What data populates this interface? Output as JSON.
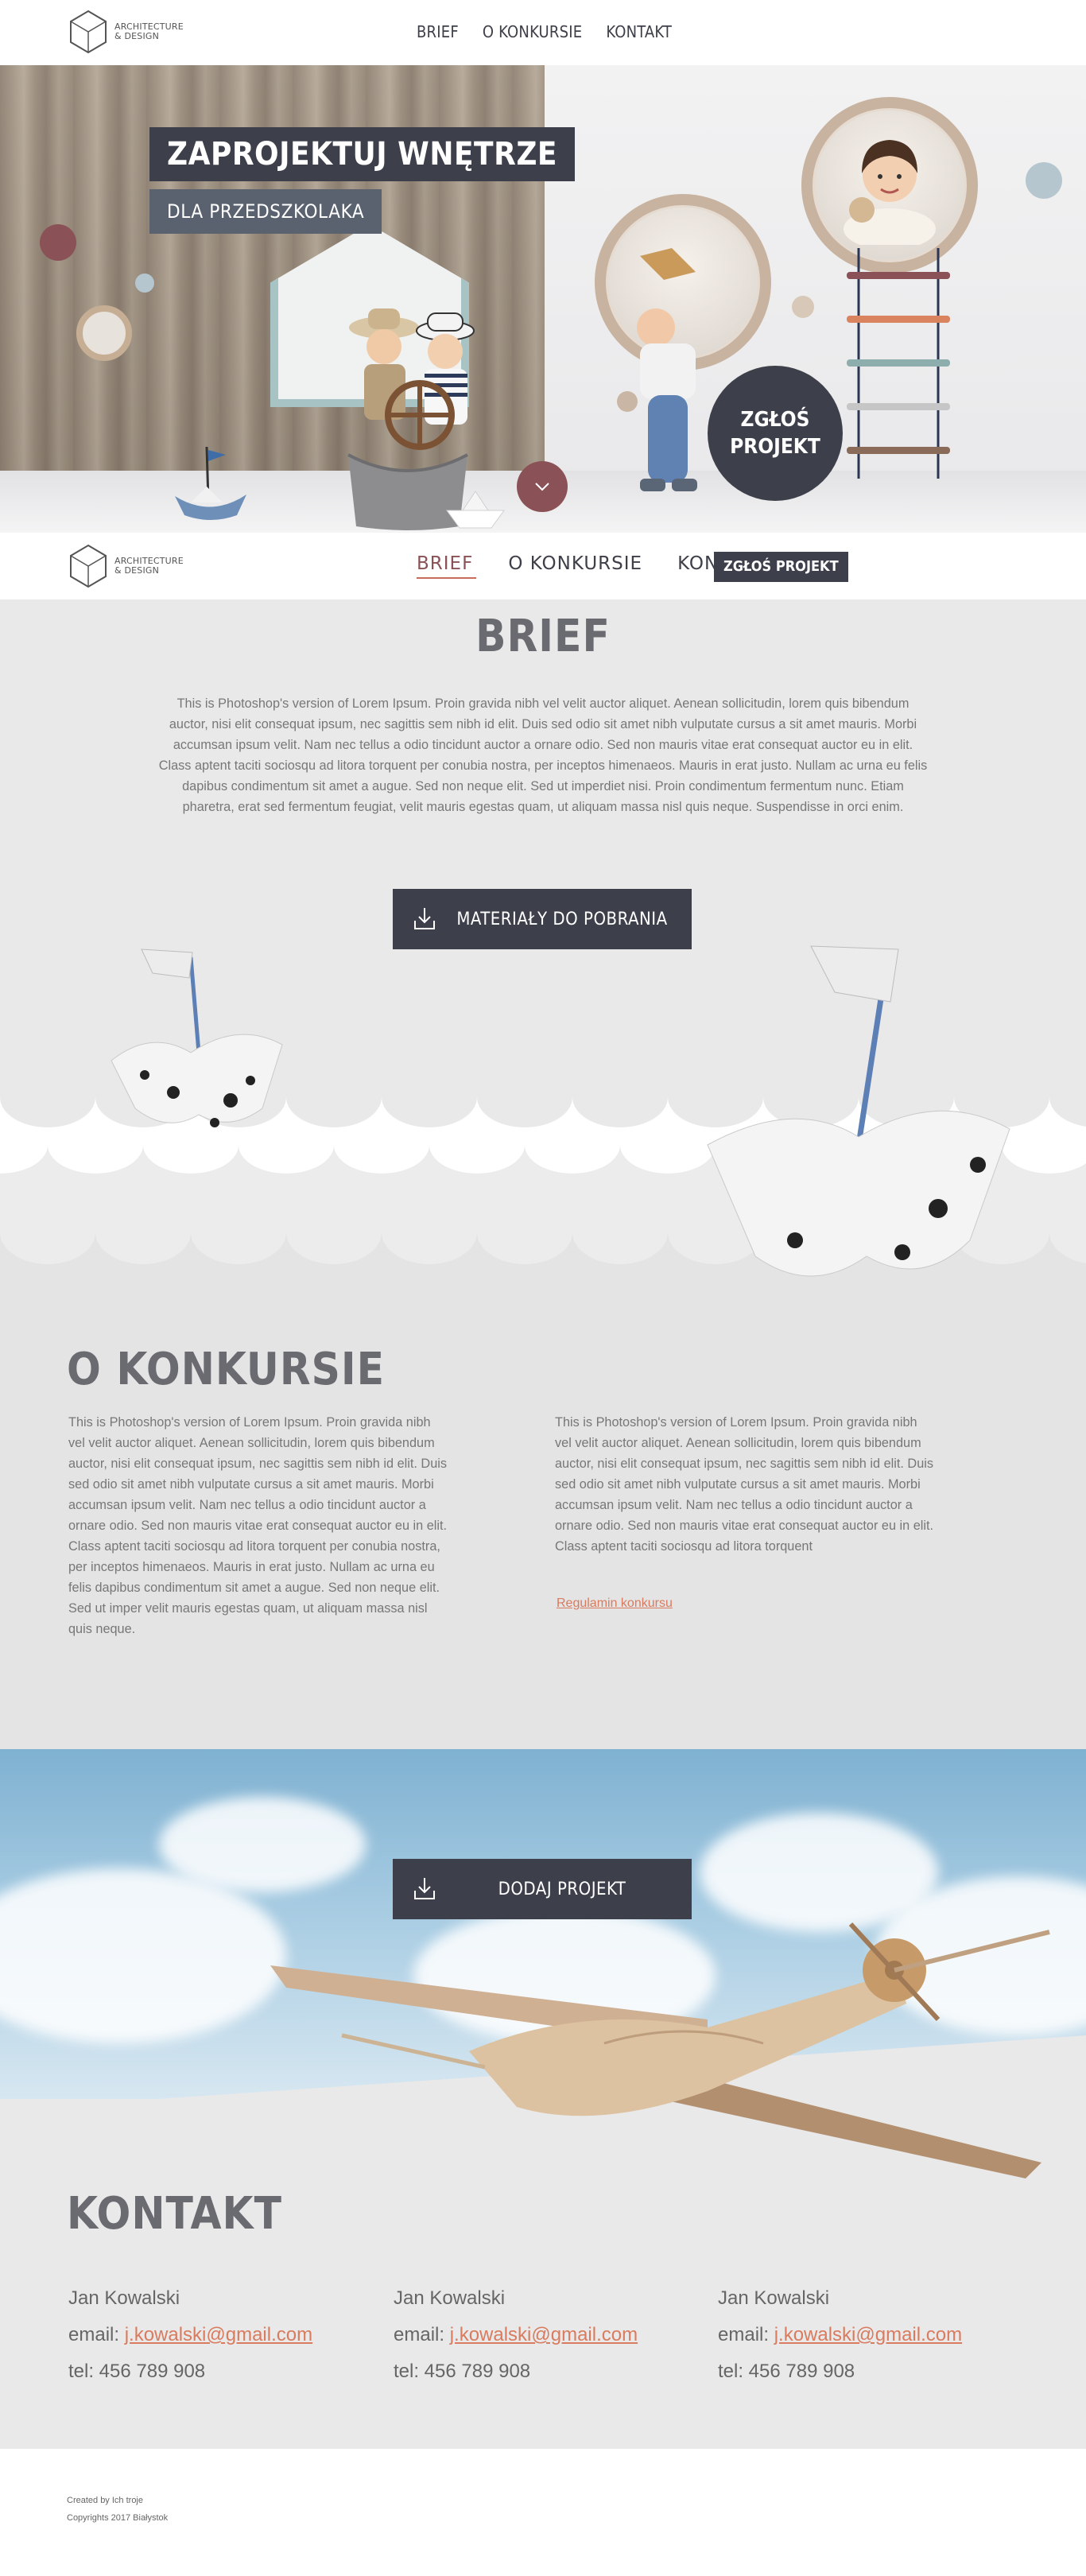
{
  "brand": {
    "logo_line1": "ARCHITECTURE",
    "logo_line2": "& DESIGN"
  },
  "topnav": {
    "items": [
      "BRIEF",
      "O KONKURSIE",
      "KONTAKT"
    ]
  },
  "hero": {
    "title": "ZAPROJEKTUJ WNĘTRZE",
    "subtitle": "DLA PRZEDSZKOLAKA",
    "cta_line1": "ZGŁOŚ",
    "cta_line2": "PROJEKT"
  },
  "sticky": {
    "items": [
      "BRIEF",
      "O KONKURSIE",
      "KON"
    ],
    "cta": "ZGŁOŚ PROJEKT"
  },
  "brief": {
    "title": "BRIEF",
    "text": "This is Photoshop's version  of Lorem Ipsum. Proin gravida nibh vel velit auctor aliquet. Aenean sollicitudin, lorem quis bibendum auctor, nisi elit consequat ipsum, nec sagittis sem nibh id elit. Duis sed odio sit amet nibh vulputate cursus a sit amet mauris. Morbi accumsan ipsum velit. Nam nec tellus a odio tincidunt auctor a ornare odio. Sed non mauris vitae erat consequat auctor eu in elit. Class aptent taciti sociosqu ad litora torquent per conubia nostra, per inceptos himenaeos. Mauris in erat justo. Nullam ac urna eu felis dapibus condimentum sit amet a augue. Sed non neque elit. Sed ut imperdiet nisi. Proin condimentum fermentum nunc. Etiam pharetra, erat sed fermentum feugiat, velit mauris egestas quam, ut aliquam massa nisl quis neque. Suspendisse in orci enim.",
    "download_label": "MATERIAŁY DO POBRANIA"
  },
  "about": {
    "title": "O KONKURSIE",
    "col1": "This is Photoshop's version  of Lorem Ipsum. Proin gravida nibh vel velit auctor aliquet. Aenean sollicitudin, lorem quis bibendum auctor, nisi elit consequat ipsum, nec sagittis sem nibh id elit. Duis sed odio sit amet nibh vulputate cursus a sit amet mauris. Morbi accumsan ipsum velit. Nam nec tellus a odio tincidunt auctor a ornare odio. Sed non  mauris vitae erat consequat auctor eu in elit. Class aptent taciti sociosqu ad litora torquent per conubia nostra, per inceptos himenaeos. Mauris in erat justo. Nullam ac urna eu felis dapibus condimentum sit amet a augue. Sed non neque elit. Sed ut imper velit mauris egestas quam, ut aliquam massa nisl quis neque.",
    "col2": "This is Photoshop's version  of Lorem Ipsum. Proin gravida nibh vel velit auctor aliquet. Aenean sollicitudin, lorem quis bibendum auctor, nisi elit consequat ipsum, nec sagittis sem nibh id elit. Duis sed odio sit amet nibh vulputate cursus a sit amet mauris. Morbi accumsan ipsum velit. Nam nec tellus a odio tincidunt auctor a ornare odio. Sed non  mauris vitae erat consequat auctor eu in elit. Class aptent taciti sociosqu ad litora torquent",
    "rules_link": "Regulamin konkursu"
  },
  "upload": {
    "label": "DODAJ PROJEKT"
  },
  "kontakt": {
    "title": "KONTAKT",
    "email_prefix": "email: ",
    "contacts": [
      {
        "name": "Jan Kowalski",
        "email": "j.kowalski@gmail.com",
        "tel": "tel: 456 789 908"
      },
      {
        "name": "Jan Kowalski",
        "email": "j.kowalski@gmail.com",
        "tel": "tel: 456 789 908"
      },
      {
        "name": "Jan Kowalski",
        "email": "j.kowalski@gmail.com",
        "tel": "tel: 456 789 908"
      }
    ]
  },
  "footer": {
    "line1": "Created by  Ich troje",
    "line2": "Copyrights 2017 Białystok"
  },
  "colors": {
    "dark": "#3d404b",
    "accent": "#d97b5e",
    "maroon": "#8a5257",
    "bg": "#e9e9ea"
  },
  "icons": {
    "download": "download-icon",
    "chevron": "chevron-down-icon",
    "logo": "cube-logo-icon"
  }
}
